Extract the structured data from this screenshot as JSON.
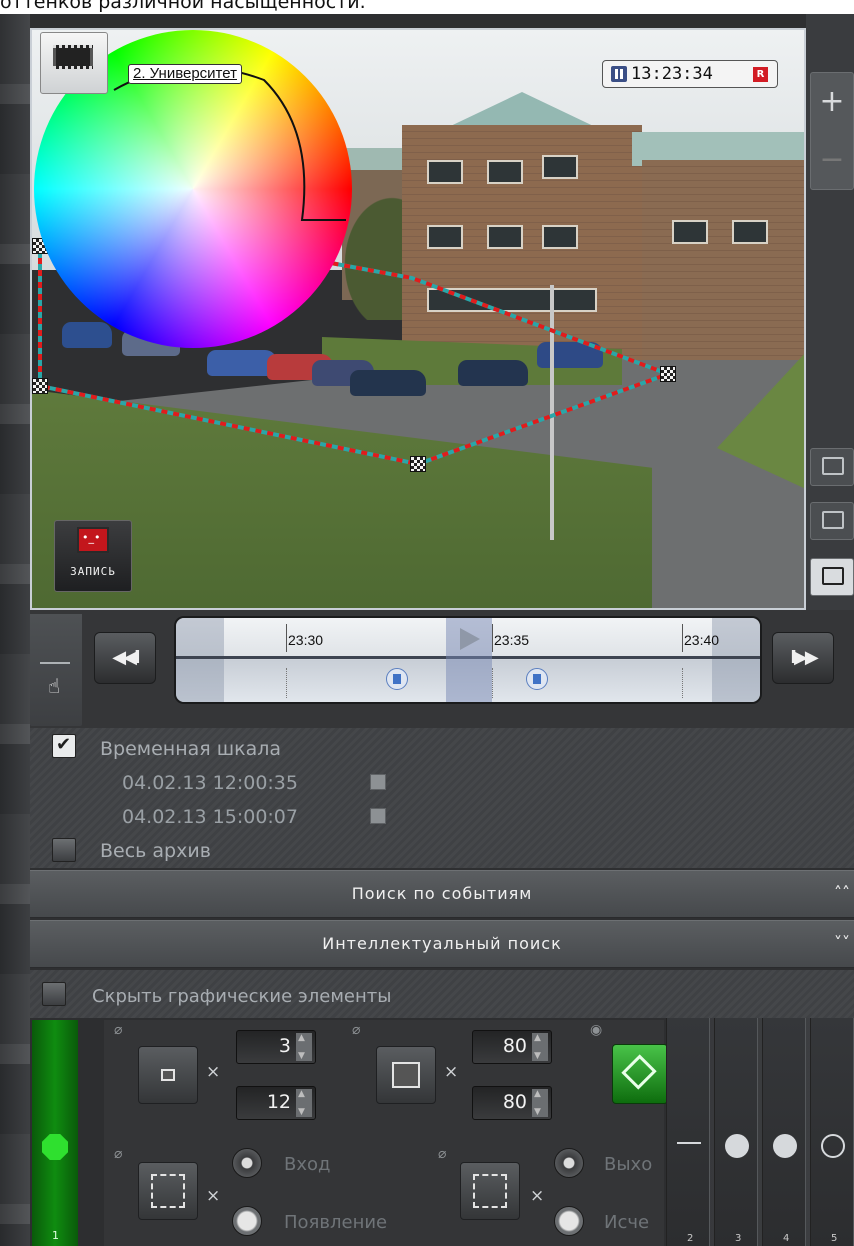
{
  "caption": "оттенков различной насыщенности.",
  "video": {
    "camera_label": "2. Университет",
    "time": "13:23:34",
    "rec_badge": "R",
    "record_button": "ЗАПИСЬ"
  },
  "side_controls": {
    "zoom_in": "+",
    "zoom_out": "−"
  },
  "timeline": {
    "ticks": [
      "23:30",
      "23:35",
      "23:40"
    ],
    "prev_label": "◀◀I",
    "next_label": "I▶▶"
  },
  "filters": {
    "timeline_label": "Временная шкала",
    "timeline_checked": true,
    "date_from": "04.02.13 12:00:35",
    "date_to": "04.02.13 15:00:07",
    "all_archive_label": "Весь архив",
    "all_archive_checked": false
  },
  "accordion": {
    "event_search": "Поиск по событиям",
    "event_chevron": "˄˄",
    "smart_search": "Интеллектуальный поиск",
    "smart_chevron": "˅˅"
  },
  "hide_graphics_label": "Скрыть графические элементы",
  "tools": {
    "min_size": {
      "w": "3",
      "h": "12"
    },
    "max_size": {
      "w": "80",
      "h": "80"
    },
    "times": "×",
    "enter_label": "Вход",
    "appear_label": "Появление",
    "exit_label": "Выхо",
    "disappear_label": "Исче",
    "tab_number": "1",
    "right_tab_numbers": [
      "2",
      "3",
      "4",
      "5"
    ]
  }
}
